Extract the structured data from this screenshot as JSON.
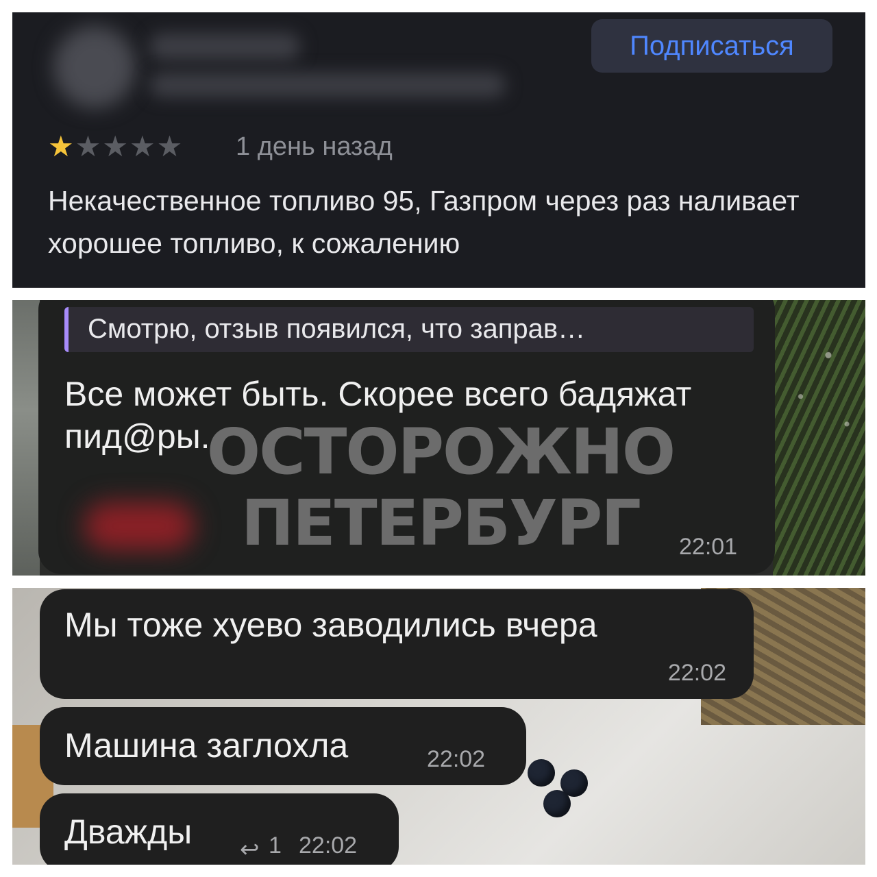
{
  "review": {
    "subscribe_label": "Подписаться",
    "rating": 1,
    "stars": [
      "★",
      "★",
      "★",
      "★",
      "★"
    ],
    "date": "1 день назад",
    "text": "Некачественное топливо 95, Газпром через раз наливает хорошее топливо, к сожалению",
    "colors": {
      "accent": "#4f87ff",
      "star_on": "#f6c43a"
    }
  },
  "quote_message": {
    "reply_preview": "Смотрю, отзыв появился, что заправ…",
    "text": "Все может быть. Скорее всего бадяжат пид@ры.",
    "watermark_line1": "ОСТОРОЖНО",
    "watermark_line2": "ПЕТЕРБУРГ",
    "time": "22:01"
  },
  "chat": {
    "messages": [
      {
        "text": "Мы тоже хуево заводились вчера",
        "time": "22:02"
      },
      {
        "text": "Машина заглохла",
        "time": "22:02"
      },
      {
        "text": "Дважды",
        "time": "22:02",
        "replies": "1",
        "reply_icon": "reply-arrow-icon"
      }
    ]
  }
}
